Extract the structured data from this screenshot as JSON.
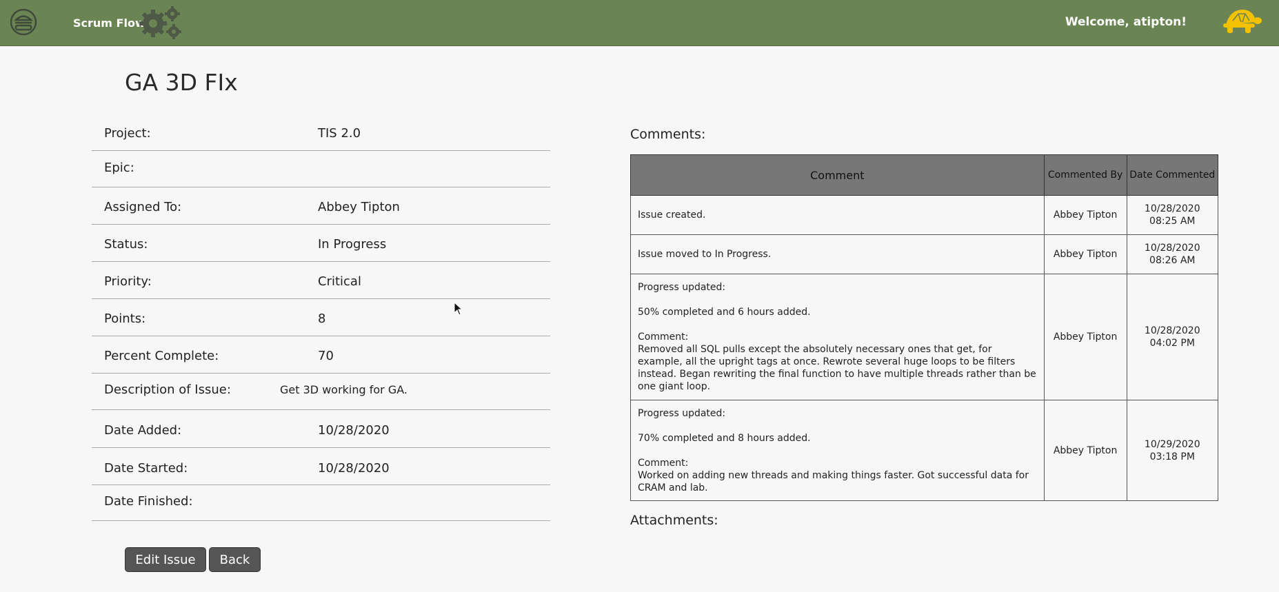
{
  "header": {
    "brand": "Scrum Flow",
    "welcome": "Welcome, atipton!"
  },
  "icons": {
    "menu": "hamburger-icon",
    "logo": "gears-icon",
    "avatar": "turtle-icon",
    "accent": "#6a8553",
    "avatar_color": "#f2c200"
  },
  "issue": {
    "title": "GA 3D FIx",
    "fields": [
      {
        "label": "Project:",
        "value": "TIS 2.0"
      },
      {
        "label": "Epic:",
        "value": ""
      },
      {
        "label": "Assigned To:",
        "value": "Abbey Tipton"
      },
      {
        "label": "Status:",
        "value": "In Progress"
      },
      {
        "label": "Priority:",
        "value": "Critical"
      },
      {
        "label": "Points:",
        "value": "8"
      },
      {
        "label": "Percent Complete:",
        "value": "70"
      },
      {
        "label": "Description of Issue:",
        "value": "Get 3D working for GA."
      },
      {
        "label": "Date Added:",
        "value": "10/28/2020"
      },
      {
        "label": "Date Started:",
        "value": "10/28/2020"
      },
      {
        "label": "Date Finished:",
        "value": ""
      }
    ]
  },
  "comments": {
    "label": "Comments:",
    "headers": [
      "Comment",
      "Commented By",
      "Date Commented"
    ],
    "rows": [
      {
        "comment": [
          "Issue created."
        ],
        "by": "Abbey Tipton",
        "date": "10/28/2020 08:25 AM"
      },
      {
        "comment": [
          "Issue moved to In Progress."
        ],
        "by": "Abbey Tipton",
        "date": "10/28/2020 08:26 AM"
      },
      {
        "comment": [
          "Progress updated:",
          "",
          "50% completed and 6 hours added.",
          "",
          "Comment:",
          "Removed all SQL pulls except the absolutely necessary ones that get, for example, all the upright tags at once. Rewrote several huge loops to be filters instead. Began rewriting the final function to have multiple threads rather than be one giant loop."
        ],
        "by": "Abbey Tipton",
        "date": "10/28/2020 04:02 PM"
      },
      {
        "comment": [
          "Progress updated:",
          "",
          "70% completed and 8 hours added.",
          "",
          "Comment:",
          "Worked on adding new threads and making things faster. Got successful data for CRAM and lab."
        ],
        "by": "Abbey Tipton",
        "date": "10/29/2020 03:18 PM"
      }
    ]
  },
  "attachments": {
    "label": "Attachments:"
  },
  "buttons": {
    "edit": "Edit Issue",
    "back": "Back"
  }
}
